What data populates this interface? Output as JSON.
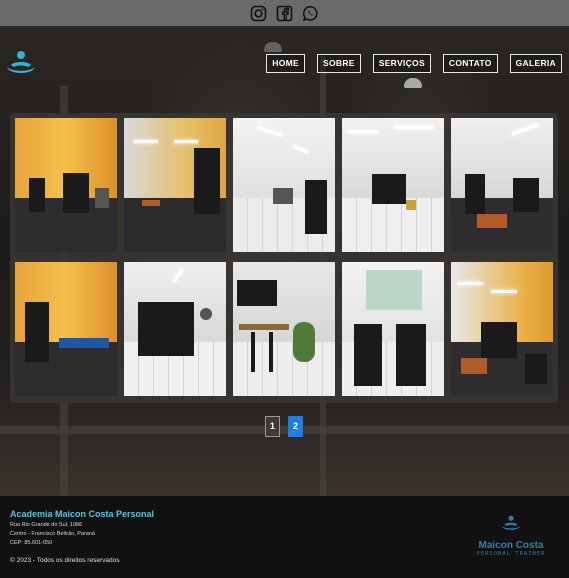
{
  "social": [
    {
      "name": "instagram"
    },
    {
      "name": "facebook"
    },
    {
      "name": "whatsapp"
    }
  ],
  "nav": {
    "items": [
      "HOME",
      "SOBRE",
      "SERVIÇOS",
      "CONTATO",
      "GALERIA"
    ]
  },
  "gallery": {
    "photo_count": 10
  },
  "pagination": {
    "pages": [
      "1",
      "2"
    ],
    "current": "2"
  },
  "footer": {
    "title": "Academia Maicon Costa Personal",
    "address_line1": "Rua Rio Grande do Sul, 1086",
    "address_line2": "Centro - Francisco Beltrão, Paraná",
    "cep": "CEP: 85.601-050",
    "copyright": "© 2023 - Todos os direitos reservados",
    "logo_name": "Maicon Costa",
    "logo_sub": "PERSONAL TRAINER"
  },
  "colors": {
    "accent": "#57c4dc",
    "brand_blue": "#2b7fae",
    "active_page": "#1e7fe0"
  }
}
